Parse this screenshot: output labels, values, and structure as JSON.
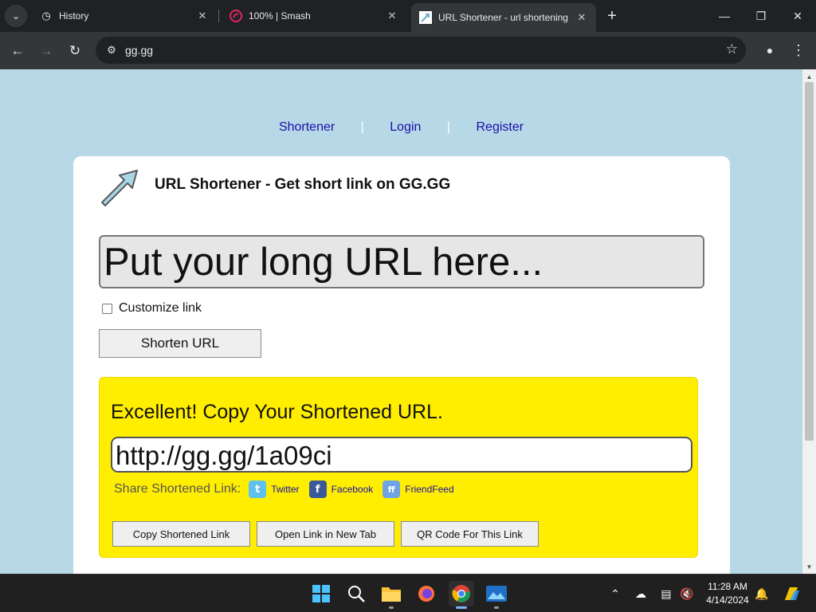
{
  "browser": {
    "tabs": [
      {
        "title": "History",
        "icon": "history-icon",
        "active": false
      },
      {
        "title": "100% | Smash",
        "icon": "smash-logo-icon",
        "active": false
      },
      {
        "title": "URL Shortener - url shortening",
        "icon": "gg-arrow-favicon-icon",
        "active": true
      }
    ],
    "address": "gg.gg"
  },
  "page": {
    "nav": {
      "shortener": "Shortener",
      "login": "Login",
      "register": "Register",
      "separator": "|"
    },
    "headline": "URL Shortener - Get short link on GG.GG",
    "long_url_placeholder": "Put your long URL here...",
    "customize_label": "Customize link",
    "customize_checked": false,
    "shorten_button": "Shorten URL",
    "result": {
      "title": "Excellent! Copy Your Shortened URL.",
      "short_url": "http://gg.gg/1a09ci",
      "share_label": "Share Shortened Link:",
      "share_services": [
        "Twitter",
        "Facebook",
        "FriendFeed"
      ],
      "buttons": {
        "copy": "Copy Shortened Link",
        "open": "Open Link in New Tab",
        "qr": "QR Code For This Link"
      }
    }
  },
  "taskbar": {
    "time": "11:28 AM",
    "date": "4/14/2024"
  },
  "colors": {
    "page_background": "#b7d8e6",
    "result_background": "#ffee00",
    "link": "#1a0dab"
  }
}
